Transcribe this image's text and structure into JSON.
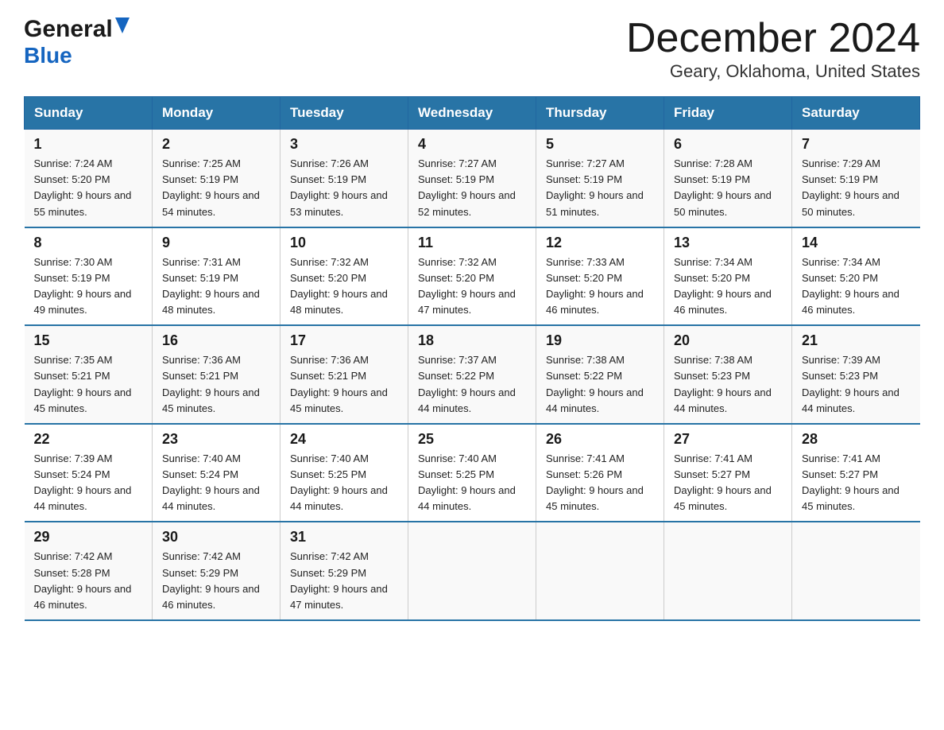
{
  "header": {
    "logo_general": "General",
    "logo_blue": "Blue",
    "month_year": "December 2024",
    "location": "Geary, Oklahoma, United States"
  },
  "columns": [
    "Sunday",
    "Monday",
    "Tuesday",
    "Wednesday",
    "Thursday",
    "Friday",
    "Saturday"
  ],
  "weeks": [
    [
      {
        "day": "1",
        "sunrise": "7:24 AM",
        "sunset": "5:20 PM",
        "daylight": "9 hours and 55 minutes."
      },
      {
        "day": "2",
        "sunrise": "7:25 AM",
        "sunset": "5:19 PM",
        "daylight": "9 hours and 54 minutes."
      },
      {
        "day": "3",
        "sunrise": "7:26 AM",
        "sunset": "5:19 PM",
        "daylight": "9 hours and 53 minutes."
      },
      {
        "day": "4",
        "sunrise": "7:27 AM",
        "sunset": "5:19 PM",
        "daylight": "9 hours and 52 minutes."
      },
      {
        "day": "5",
        "sunrise": "7:27 AM",
        "sunset": "5:19 PM",
        "daylight": "9 hours and 51 minutes."
      },
      {
        "day": "6",
        "sunrise": "7:28 AM",
        "sunset": "5:19 PM",
        "daylight": "9 hours and 50 minutes."
      },
      {
        "day": "7",
        "sunrise": "7:29 AM",
        "sunset": "5:19 PM",
        "daylight": "9 hours and 50 minutes."
      }
    ],
    [
      {
        "day": "8",
        "sunrise": "7:30 AM",
        "sunset": "5:19 PM",
        "daylight": "9 hours and 49 minutes."
      },
      {
        "day": "9",
        "sunrise": "7:31 AM",
        "sunset": "5:19 PM",
        "daylight": "9 hours and 48 minutes."
      },
      {
        "day": "10",
        "sunrise": "7:32 AM",
        "sunset": "5:20 PM",
        "daylight": "9 hours and 48 minutes."
      },
      {
        "day": "11",
        "sunrise": "7:32 AM",
        "sunset": "5:20 PM",
        "daylight": "9 hours and 47 minutes."
      },
      {
        "day": "12",
        "sunrise": "7:33 AM",
        "sunset": "5:20 PM",
        "daylight": "9 hours and 46 minutes."
      },
      {
        "day": "13",
        "sunrise": "7:34 AM",
        "sunset": "5:20 PM",
        "daylight": "9 hours and 46 minutes."
      },
      {
        "day": "14",
        "sunrise": "7:34 AM",
        "sunset": "5:20 PM",
        "daylight": "9 hours and 46 minutes."
      }
    ],
    [
      {
        "day": "15",
        "sunrise": "7:35 AM",
        "sunset": "5:21 PM",
        "daylight": "9 hours and 45 minutes."
      },
      {
        "day": "16",
        "sunrise": "7:36 AM",
        "sunset": "5:21 PM",
        "daylight": "9 hours and 45 minutes."
      },
      {
        "day": "17",
        "sunrise": "7:36 AM",
        "sunset": "5:21 PM",
        "daylight": "9 hours and 45 minutes."
      },
      {
        "day": "18",
        "sunrise": "7:37 AM",
        "sunset": "5:22 PM",
        "daylight": "9 hours and 44 minutes."
      },
      {
        "day": "19",
        "sunrise": "7:38 AM",
        "sunset": "5:22 PM",
        "daylight": "9 hours and 44 minutes."
      },
      {
        "day": "20",
        "sunrise": "7:38 AM",
        "sunset": "5:23 PM",
        "daylight": "9 hours and 44 minutes."
      },
      {
        "day": "21",
        "sunrise": "7:39 AM",
        "sunset": "5:23 PM",
        "daylight": "9 hours and 44 minutes."
      }
    ],
    [
      {
        "day": "22",
        "sunrise": "7:39 AM",
        "sunset": "5:24 PM",
        "daylight": "9 hours and 44 minutes."
      },
      {
        "day": "23",
        "sunrise": "7:40 AM",
        "sunset": "5:24 PM",
        "daylight": "9 hours and 44 minutes."
      },
      {
        "day": "24",
        "sunrise": "7:40 AM",
        "sunset": "5:25 PM",
        "daylight": "9 hours and 44 minutes."
      },
      {
        "day": "25",
        "sunrise": "7:40 AM",
        "sunset": "5:25 PM",
        "daylight": "9 hours and 44 minutes."
      },
      {
        "day": "26",
        "sunrise": "7:41 AM",
        "sunset": "5:26 PM",
        "daylight": "9 hours and 45 minutes."
      },
      {
        "day": "27",
        "sunrise": "7:41 AM",
        "sunset": "5:27 PM",
        "daylight": "9 hours and 45 minutes."
      },
      {
        "day": "28",
        "sunrise": "7:41 AM",
        "sunset": "5:27 PM",
        "daylight": "9 hours and 45 minutes."
      }
    ],
    [
      {
        "day": "29",
        "sunrise": "7:42 AM",
        "sunset": "5:28 PM",
        "daylight": "9 hours and 46 minutes."
      },
      {
        "day": "30",
        "sunrise": "7:42 AM",
        "sunset": "5:29 PM",
        "daylight": "9 hours and 46 minutes."
      },
      {
        "day": "31",
        "sunrise": "7:42 AM",
        "sunset": "5:29 PM",
        "daylight": "9 hours and 47 minutes."
      },
      null,
      null,
      null,
      null
    ]
  ],
  "labels": {
    "sunrise_prefix": "Sunrise: ",
    "sunset_prefix": "Sunset: ",
    "daylight_prefix": "Daylight: "
  }
}
